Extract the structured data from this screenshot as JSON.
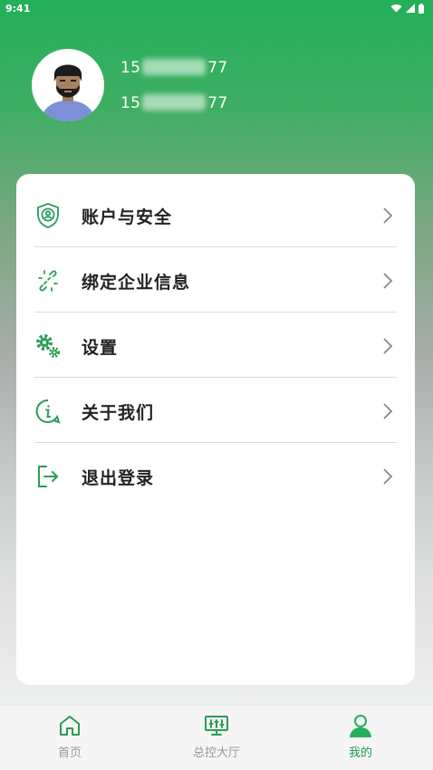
{
  "status_bar": {
    "time": "9:41"
  },
  "profile": {
    "line1_start": "15",
    "line1_end": "77",
    "line2_start": "15",
    "line2_end": "77"
  },
  "menu": [
    {
      "label": "账户与安全",
      "icon": "shield-user-icon"
    },
    {
      "label": "绑定企业信息",
      "icon": "broken-link-icon"
    },
    {
      "label": "设置",
      "icon": "gears-icon"
    },
    {
      "label": "关于我们",
      "icon": "info-icon"
    },
    {
      "label": "退出登录",
      "icon": "logout-icon"
    }
  ],
  "tabbar": [
    {
      "label": "首页",
      "icon": "home-icon"
    },
    {
      "label": "总控大厅",
      "icon": "control-panel-icon"
    },
    {
      "label": "我的",
      "icon": "user-icon"
    }
  ],
  "colors": {
    "primary": "#23b05a",
    "active_tab": "#1f9b4e",
    "inactive_tab": "#999999"
  }
}
